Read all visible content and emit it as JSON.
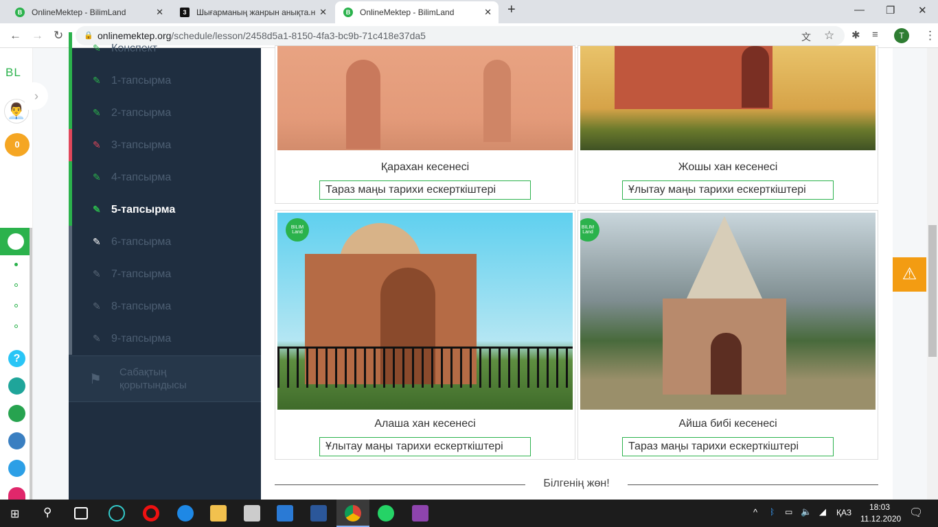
{
  "browser": {
    "tabs": [
      {
        "title": "OnlineMektep - BilimLand"
      },
      {
        "title": "Шығарманың жанрын анықта.н"
      },
      {
        "title": "OnlineMektep - BilimLand"
      }
    ],
    "url_domain": "onlinemektep.org",
    "url_path": "/schedule/lesson/2458d5a1-8150-4fa3-bc9b-71c418e37da5",
    "profile_initial": "T"
  },
  "rail": {
    "logo": "BL",
    "points": "0"
  },
  "sidebar": {
    "items": [
      {
        "label": "Конспект",
        "status": "done"
      },
      {
        "label": "1-тапсырма",
        "status": "correct"
      },
      {
        "label": "2-тапсырма",
        "status": "correct"
      },
      {
        "label": "3-тапсырма",
        "status": "wrong"
      },
      {
        "label": "4-тапсырма",
        "status": "correct"
      },
      {
        "label": "5-тапсырма",
        "status": "current"
      },
      {
        "label": "6-тапсырма",
        "status": "next"
      },
      {
        "label": "7-тапсырма",
        "status": "locked"
      },
      {
        "label": "8-тапсырма",
        "status": "locked"
      },
      {
        "label": "9-тапсырма",
        "status": "locked"
      }
    ],
    "summary": "Сабақтың қорытындысы"
  },
  "cards": [
    {
      "title": "Қарахан кесенесі",
      "answer": "Тараз маңы тарихи ескерткіштері"
    },
    {
      "title": "Жошы хан кесенесі",
      "answer": "Ұлытау маңы тарихи ескерткіштері"
    },
    {
      "title": "Алаша хан кесенесі",
      "answer": "Ұлытау маңы тарихи ескерткіштері"
    },
    {
      "title": "Айша бибі кесенесі",
      "answer": "Тараз маңы тарихи ескерткіштері"
    }
  ],
  "watermark": "BILIM Land",
  "footer_text": "Білгенің жөн!",
  "taskbar": {
    "lang": "ҚАЗ",
    "time": "18:03",
    "date": "11.12.2020"
  },
  "colors": {
    "accent": "#2bb24c",
    "sidebar": "#1f2e40",
    "warning": "#f39c12",
    "wrong": "#e0475b"
  }
}
